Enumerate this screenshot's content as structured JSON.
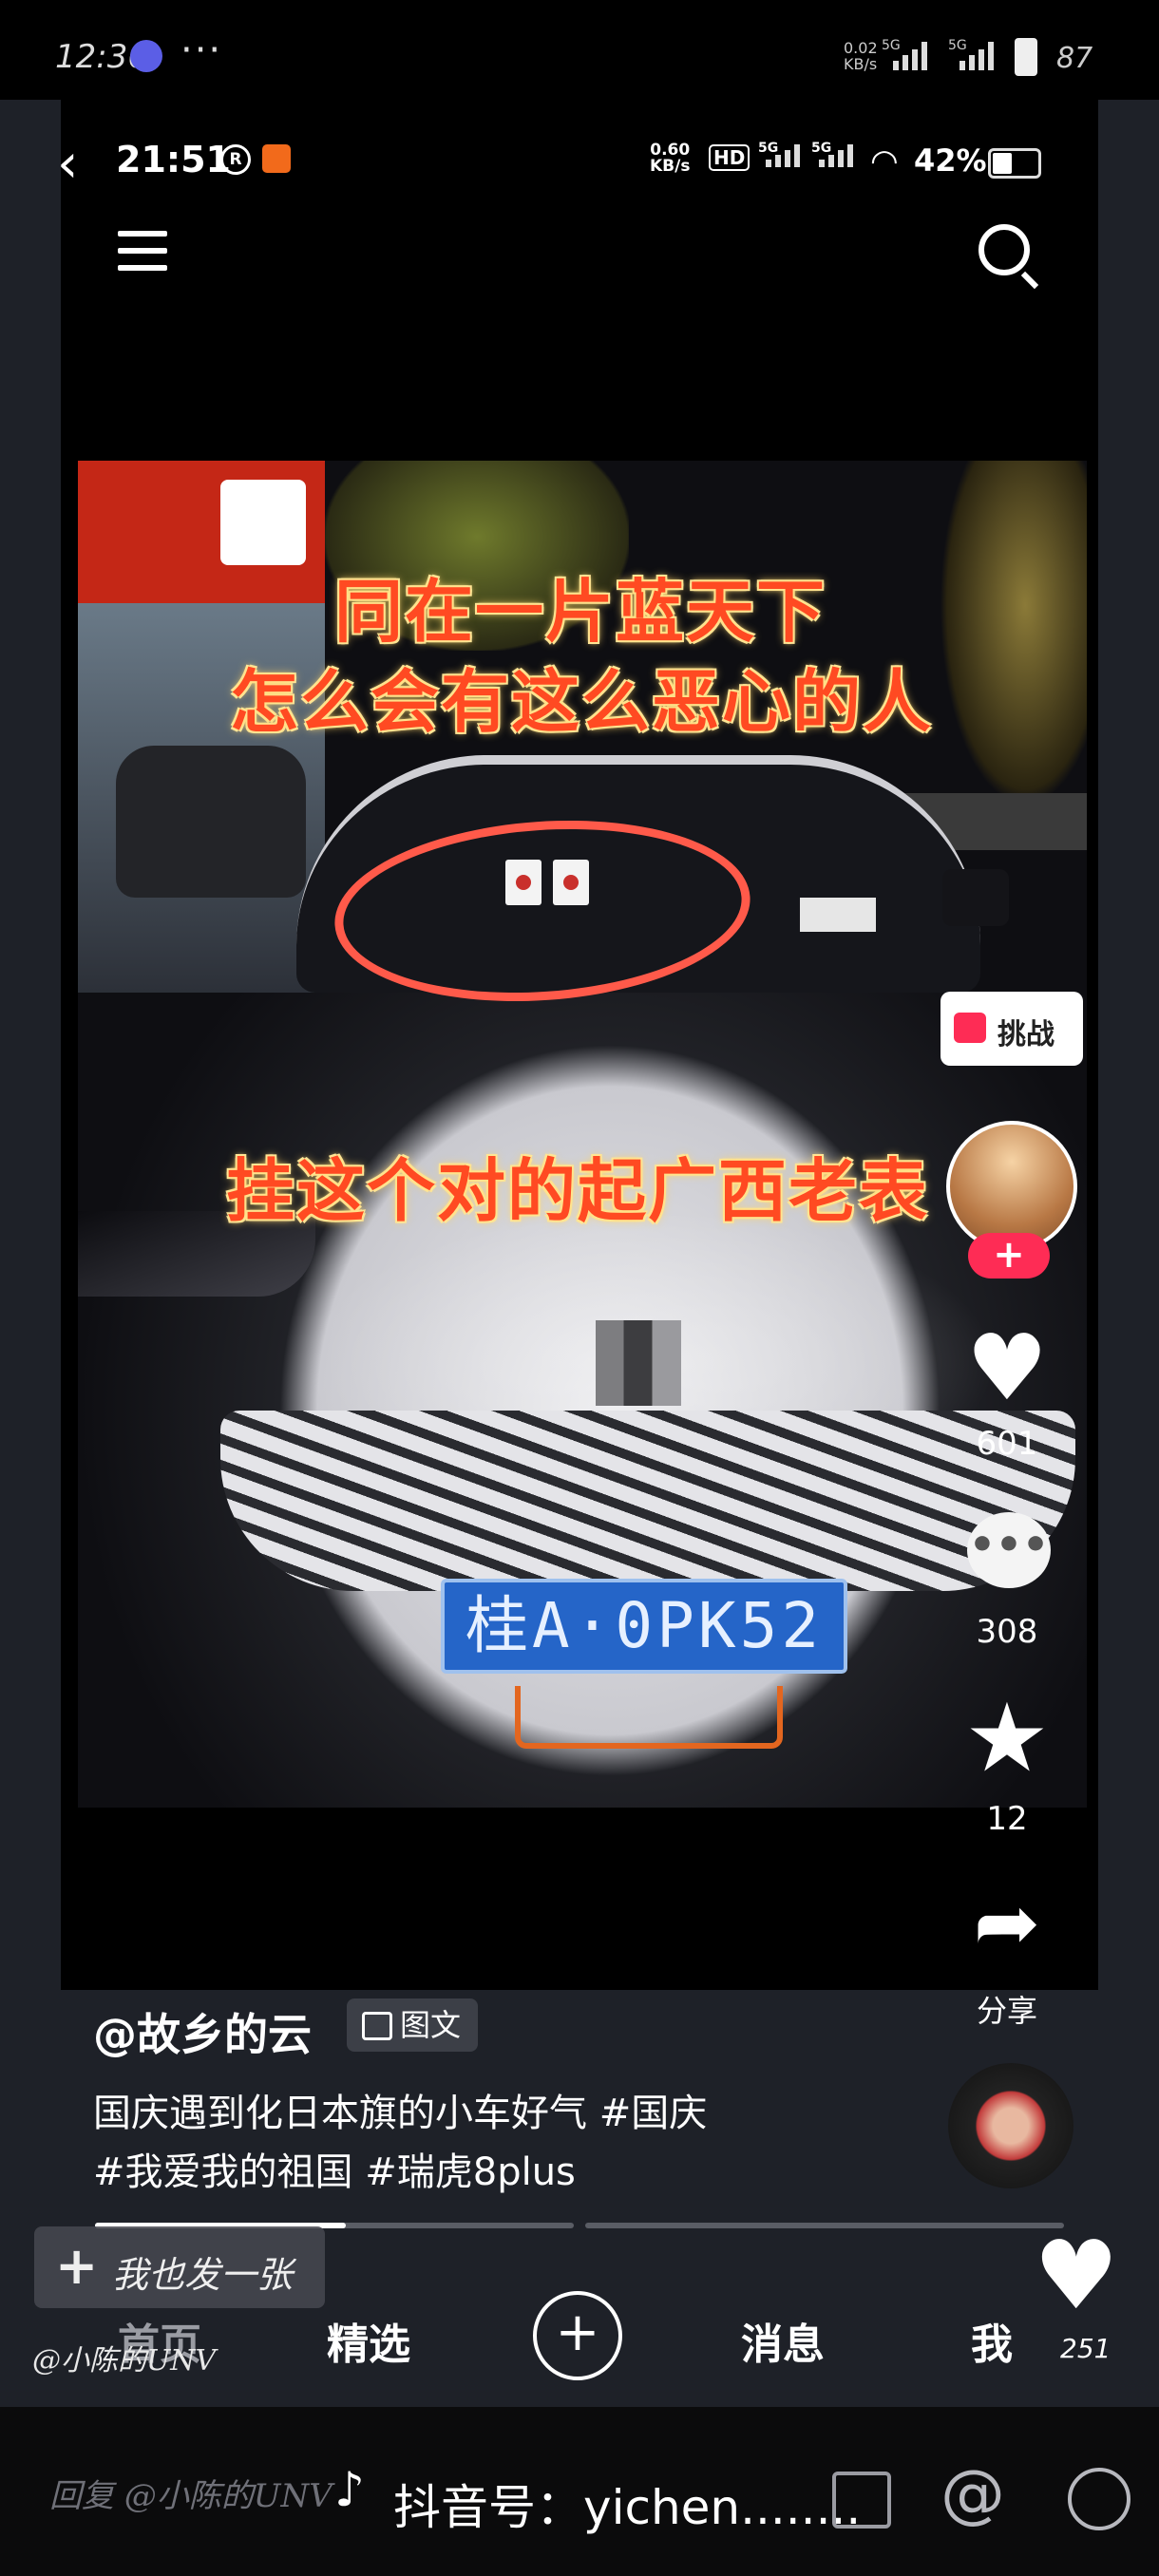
{
  "outer_status": {
    "time": "12:36",
    "dots": "···",
    "rate_top": "0.02",
    "rate_bottom": "KB/s",
    "net": "5G",
    "battery": "87"
  },
  "inner_status": {
    "time": "21:51",
    "r_badge": "R",
    "kbs_top": "0.60",
    "kbs_bottom": "KB/s",
    "hd": "HD",
    "net": "5G",
    "battery": "42%"
  },
  "post": {
    "captions": [
      "同在一片蓝天下",
      "怎么会有这么恶心的人",
      "挂这个对的起广西老表"
    ],
    "plate": "桂A·0PK52",
    "author": "@故乡的云",
    "type_badge": "图文",
    "desc_line1": "国庆遇到化日本旗的小车好气 #国庆",
    "desc_line2": "#我爱我的祖国 #瑞虎8plus"
  },
  "actions": {
    "challenge": "挑战",
    "follow": "+",
    "likes": "601",
    "comments": "308",
    "comment_glyph": "•••",
    "favorites": "12",
    "share": "分享"
  },
  "bottom": {
    "post_btn": "我也发一张",
    "plus": "+",
    "nav": [
      "首页",
      "精选",
      "+",
      "消息",
      "我"
    ],
    "heart_count": "251",
    "watermark": "@小陈的UNV"
  },
  "reply_bar": {
    "text": "回复 @小陈的UNV",
    "douyin": "抖音号：yichen........",
    "at": "@"
  },
  "colors": {
    "accent": "#fe2c55",
    "caption": "#ff4a22",
    "plate": "#2565c8"
  },
  "icons": [
    "back-icon",
    "hamburger-icon",
    "search-icon",
    "camera-icon",
    "heart-icon",
    "comment-icon",
    "star-icon",
    "share-icon",
    "image-icon",
    "at-icon",
    "emoji-icon",
    "tiktok-logo-icon"
  ]
}
